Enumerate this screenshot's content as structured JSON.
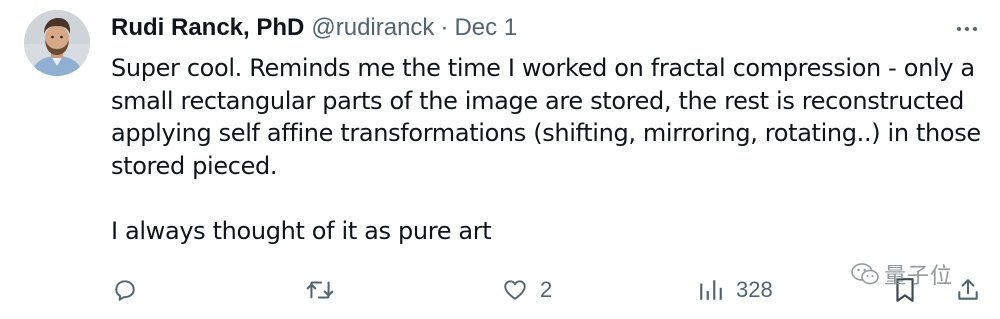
{
  "tweet": {
    "author": {
      "display_name": "Rudi Ranck, PhD",
      "handle": "@rudiranck",
      "separator": "·",
      "date": "Dec 1"
    },
    "text_paragraphs": [
      "Super cool. Reminds me the time I worked on fractal compression - only a small rectangular parts of the image are stored, the rest is reconstructed applying self affine transformations (shifting, mirroring, rotating..) in those stored pieced.",
      "I always thought of it as pure art"
    ],
    "actions": {
      "replies": {
        "icon": "reply-icon",
        "count": ""
      },
      "retweets": {
        "icon": "retweet-icon",
        "count": ""
      },
      "likes": {
        "icon": "heart-icon",
        "count": "2"
      },
      "views": {
        "icon": "views-icon",
        "count": "328"
      },
      "bookmark": {
        "icon": "bookmark-icon"
      },
      "share": {
        "icon": "share-icon"
      }
    },
    "more_icon": "more-icon"
  },
  "watermark": {
    "text": "量子位",
    "icon": "wechat-icon"
  },
  "colors": {
    "primary_text": "#0f1419",
    "secondary_text": "#536471",
    "background": "#ffffff"
  }
}
